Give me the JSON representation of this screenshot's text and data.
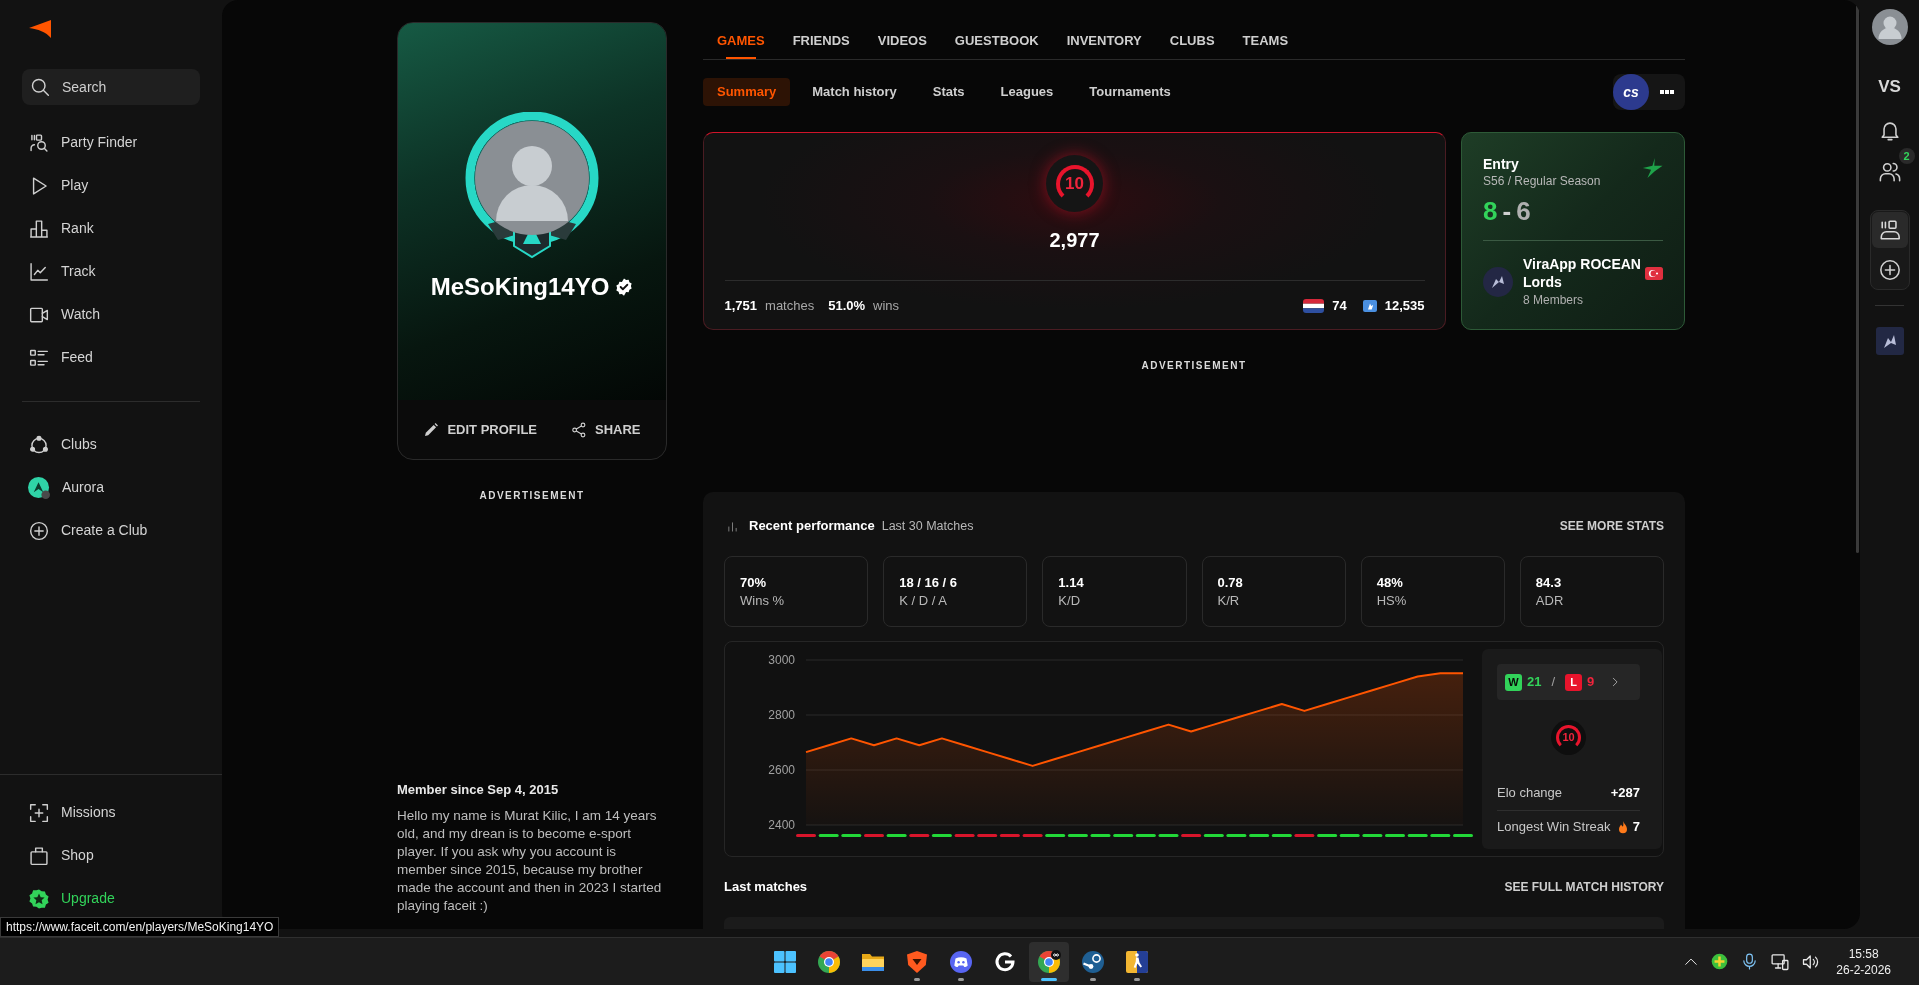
{
  "sidebar": {
    "search": {
      "placeholder": "Search"
    },
    "nav_items": [
      {
        "label": "Party Finder"
      },
      {
        "label": "Play"
      },
      {
        "label": "Rank"
      },
      {
        "label": "Track"
      },
      {
        "label": "Watch"
      },
      {
        "label": "Feed"
      }
    ],
    "club_items": [
      {
        "label": "Clubs",
        "kind": "icon"
      },
      {
        "label": "Aurora",
        "kind": "club"
      },
      {
        "label": "Create a Club",
        "kind": "icon"
      }
    ],
    "bottom_items": [
      {
        "label": "Missions",
        "kind": "icon"
      },
      {
        "label": "Shop",
        "kind": "icon"
      },
      {
        "label": "Upgrade",
        "kind": "upgrade"
      }
    ]
  },
  "profile": {
    "name": "MeSoKing14YO",
    "verified": true,
    "actions": [
      {
        "label": "EDIT PROFILE"
      },
      {
        "label": "SHARE"
      }
    ],
    "advertisement": "ADVERTISEMENT",
    "member_since": "Member since Sep 4, 2015",
    "bio": "Hello my name is Murat Kilic, I am 14 years old, and my drean is to become e-sport player. If you ask why you account is member since 2015, because my brother made the account and then in 2023 I started playing faceit :)"
  },
  "tabs": [
    {
      "label": "GAMES",
      "selected": true
    },
    {
      "label": "FRIENDS",
      "selected": false
    },
    {
      "label": "VIDEOS",
      "selected": false
    },
    {
      "label": "GUESTBOOK",
      "selected": false
    },
    {
      "label": "INVENTORY",
      "selected": false
    },
    {
      "label": "CLUBS",
      "selected": false
    },
    {
      "label": "TEAMS",
      "selected": false
    }
  ],
  "subtabs": [
    {
      "label": "Summary",
      "selected": true
    },
    {
      "label": "Match history",
      "selected": false
    },
    {
      "label": "Stats",
      "selected": false
    },
    {
      "label": "Leagues",
      "selected": false
    },
    {
      "label": "Tournaments",
      "selected": false
    }
  ],
  "game_logo": "cs",
  "elo_card": {
    "level": "10",
    "elo": "2,977",
    "matches": "1,751",
    "matches_label": "matches",
    "win_rate": "51.0%",
    "win_rate_label": "wins",
    "country_rank": "74",
    "region_rank": "12,535"
  },
  "league_card": {
    "title": "Entry",
    "season": "S56 / Regular Season",
    "wins": "8",
    "separator": "-",
    "losses": "6",
    "team": {
      "name": "ViraApp ROCEAN Lords",
      "members": "8 Members"
    }
  },
  "advertisement": "ADVERTISEMENT",
  "performance": {
    "title": "Recent performance",
    "subtitle": "Last 30 Matches",
    "link": "SEE MORE STATS",
    "stats": [
      {
        "value": "70%",
        "label": "Wins %"
      },
      {
        "value": "18 / 16 / 6",
        "label": "K / D / A"
      },
      {
        "value": "1.14",
        "label": "K/D"
      },
      {
        "value": "0.78",
        "label": "K/R"
      },
      {
        "value": "48%",
        "label": "HS%"
      },
      {
        "value": "84.3",
        "label": "ADR"
      }
    ],
    "chart": {
      "chart_data": {
        "type": "area",
        "ylim": [
          2400,
          3000
        ],
        "yticks": [
          2400,
          2600,
          2800,
          3000
        ],
        "series": [
          {
            "color": "#ff5500",
            "values": [
              2665,
              2690,
              2715,
              2690,
              2715,
              2690,
              2715,
              2690,
              2665,
              2640,
              2615,
              2640,
              2665,
              2690,
              2715,
              2740,
              2765,
              2740,
              2765,
              2790,
              2815,
              2840,
              2815,
              2840,
              2865,
              2890,
              2915,
              2940,
              2952,
              2952
            ]
          }
        ]
      },
      "match_results": [
        {
          "won": false
        },
        {
          "won": true
        },
        {
          "won": true
        },
        {
          "won": false
        },
        {
          "won": true
        },
        {
          "won": false
        },
        {
          "won": true
        },
        {
          "won": false
        },
        {
          "won": false
        },
        {
          "won": false
        },
        {
          "won": false
        },
        {
          "won": true
        },
        {
          "won": true
        },
        {
          "won": true
        },
        {
          "won": true
        },
        {
          "won": true
        },
        {
          "won": true
        },
        {
          "won": false
        },
        {
          "won": true
        },
        {
          "won": true
        },
        {
          "won": true
        },
        {
          "won": true
        },
        {
          "won": false
        },
        {
          "won": true
        },
        {
          "won": true
        },
        {
          "won": true
        },
        {
          "won": true
        },
        {
          "won": true
        },
        {
          "won": true
        },
        {
          "won": true
        }
      ]
    },
    "summary": {
      "win_badge": "W",
      "wins": "21",
      "separator": "/",
      "loss_badge": "L",
      "losses": "9",
      "level": "10",
      "rows": [
        {
          "label": "Elo change",
          "value": "+287",
          "kind": "plain"
        },
        {
          "label": "Longest Win Streak",
          "value": "7",
          "kind": "streak"
        }
      ]
    }
  },
  "last_matches": {
    "title": "Last matches",
    "link": "SEE FULL MATCH HISTORY"
  },
  "right_rail": {
    "versus": "VS",
    "friend_badge": "2"
  },
  "taskbar": {
    "apps": [
      {
        "running": false,
        "active": false
      },
      {
        "running": false,
        "active": false
      },
      {
        "running": false,
        "active": false
      },
      {
        "running": true,
        "active": false
      },
      {
        "running": true,
        "active": false
      },
      {
        "running": false,
        "active": false
      },
      {
        "running": true,
        "active": true
      },
      {
        "running": true,
        "active": false
      },
      {
        "running": true,
        "active": false
      }
    ],
    "time": "15:58",
    "date": "26-2-2026"
  },
  "status_url": "https://www.faceit.com/en/players/MeSoKing14YO"
}
